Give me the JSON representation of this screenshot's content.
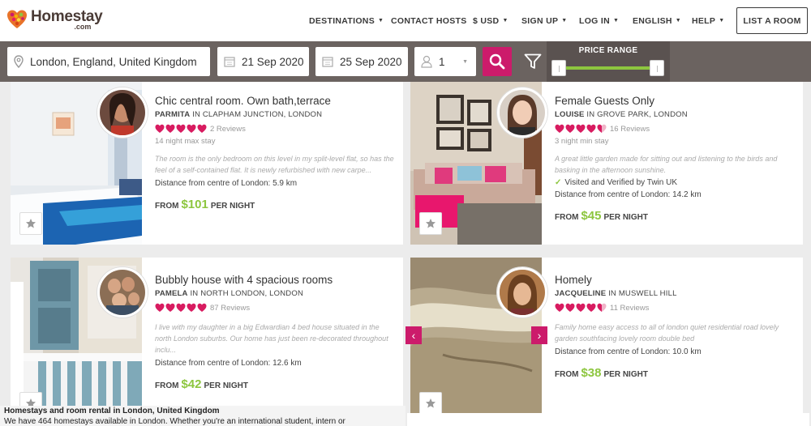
{
  "brand": {
    "name": "Homestay",
    "domain": ".com",
    "accent": "#cc1b6b",
    "green": "#8dc63f"
  },
  "nav": {
    "destinations": "DESTINATIONS",
    "contact_hosts": "CONTACT HOSTS",
    "currency": "$ USD",
    "sign_up": "SIGN UP",
    "log_in": "LOG IN",
    "language": "ENGLISH",
    "help": "HELP",
    "list_room": "LIST A ROOM"
  },
  "search": {
    "location": "London, England, United Kingdom",
    "check_in": "21 Sep 2020",
    "check_out": "25 Sep 2020",
    "guests": "1",
    "price_range_label": "PRICE RANGE"
  },
  "listings": [
    {
      "title": "Chic central room. Own bath,terrace",
      "host": "PARMITA",
      "location": "IN CLAPHAM JUNCTION, LONDON",
      "rating": 5,
      "reviews": "2 Reviews",
      "stay": "14 night max stay",
      "description": "The room is the only bedroom on this level in my split-level flat, so has the feel of a self-contained flat. It is newly refurbished with new carpe...",
      "verified": "",
      "distance": "Distance from centre of London: 5.9 km",
      "price_prefix": "FROM",
      "price": "$101",
      "price_suffix": "PER NIGHT"
    },
    {
      "title": "Female Guests Only",
      "host": "LOUISE",
      "location": "IN GROVE PARK, LONDON",
      "rating": 4.5,
      "reviews": "16 Reviews",
      "stay": "3 night min stay",
      "description": "A great little garden made for sitting out and listening to the birds and basking in the afternoon sunshine.",
      "verified": "Visited and Verified by Twin UK",
      "distance": "Distance from centre of London: 14.2 km",
      "price_prefix": "FROM",
      "price": "$45",
      "price_suffix": "PER NIGHT"
    },
    {
      "title": "Bubbly house with 4 spacious rooms",
      "host": "PAMELA",
      "location": "IN NORTH LONDON, LONDON",
      "rating": 5,
      "reviews": "87 Reviews",
      "stay": "",
      "description": "I live with my daughter in a big Edwardian 4 bed house situated in the north London suburbs. Our home has just been re-decorated throughout inclu...",
      "verified": "",
      "distance": "Distance from centre of London: 12.6 km",
      "price_prefix": "FROM",
      "price": "$42",
      "price_suffix": "PER NIGHT"
    },
    {
      "title": "Homely",
      "host": "JACQUELINE",
      "location": "IN MUSWELL HILL",
      "rating": 4.5,
      "reviews": "11 Reviews",
      "stay": "",
      "description": "Family home easy access to all of london quiet residential road lovely garden southfacing lovely room double bed",
      "verified": "",
      "distance": "Distance from centre of London: 10.0 km",
      "price_prefix": "FROM",
      "price": "$38",
      "price_suffix": "PER NIGHT"
    }
  ],
  "footer": {
    "title": "Homestays and room rental in London, United Kingdom",
    "text": "We have 464 homestays available in London. Whether you're an international student, intern or"
  }
}
